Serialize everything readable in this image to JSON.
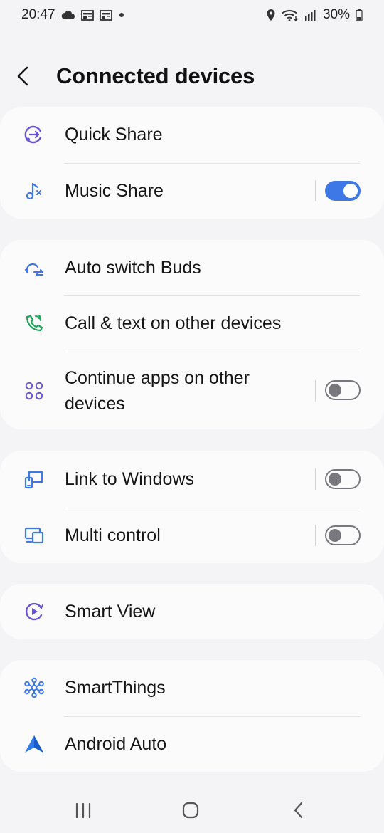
{
  "status_bar": {
    "time": "20:47",
    "battery": "30%",
    "icons_left": [
      "cloud-icon",
      "news-icon",
      "news-icon",
      "dot-icon"
    ],
    "icons_right": [
      "location-icon",
      "wifi-icon",
      "signal-icon",
      "battery-icon"
    ]
  },
  "header": {
    "title": "Connected devices"
  },
  "groups": [
    {
      "items": [
        {
          "label": "Quick Share",
          "icon": "quick-share-icon"
        },
        {
          "label": "Music Share",
          "icon": "music-share-icon",
          "toggle": true
        }
      ]
    },
    {
      "items": [
        {
          "label": "Auto switch Buds",
          "icon": "auto-switch-buds-icon"
        },
        {
          "label": "Call & text on other devices",
          "icon": "call-text-icon"
        },
        {
          "label": "Continue apps on other devices",
          "icon": "continue-apps-icon",
          "toggle": false
        }
      ]
    },
    {
      "items": [
        {
          "label": "Link to Windows",
          "icon": "link-to-windows-icon",
          "toggle": false
        },
        {
          "label": "Multi control",
          "icon": "multi-control-icon",
          "toggle": false
        }
      ]
    },
    {
      "items": [
        {
          "label": "Smart View",
          "icon": "smart-view-icon"
        }
      ]
    },
    {
      "items": [
        {
          "label": "SmartThings",
          "icon": "smartthings-icon"
        },
        {
          "label": "Android Auto",
          "icon": "android-auto-icon"
        }
      ]
    }
  ],
  "colors": {
    "accent_blue": "#3e78e6",
    "icon_purple": "#6a52d6",
    "icon_green": "#1fa55a",
    "background": "#f4f4f6",
    "card": "#fbfbfc"
  },
  "nav": {
    "icons": [
      "recent-apps-icon",
      "home-icon",
      "back-icon"
    ]
  }
}
